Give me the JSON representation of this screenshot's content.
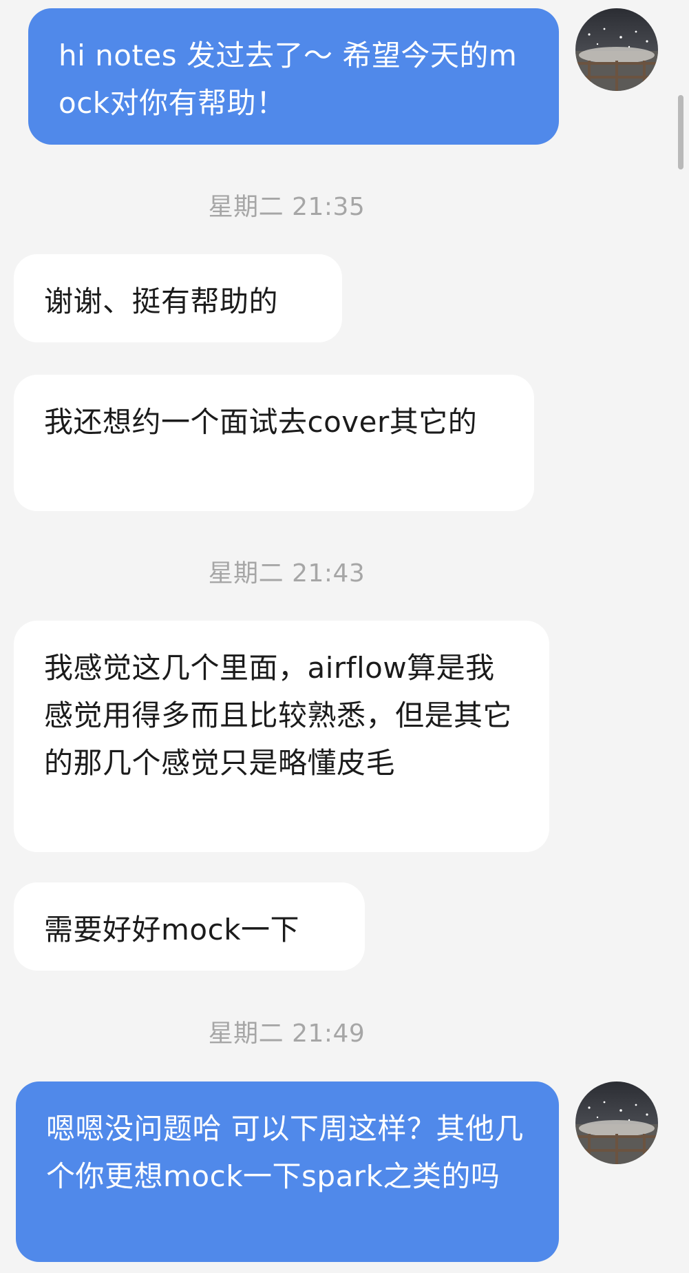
{
  "conversation": {
    "messages": [
      {
        "direction": "out",
        "text": "hi notes 发过去了～ 希望今天的mock对你有帮助！"
      },
      {
        "direction": "in",
        "text": "谢谢、挺有帮助的"
      },
      {
        "direction": "in",
        "text": "我还想约一个面试去cover其它的"
      },
      {
        "direction": "in",
        "text": "我感觉这几个里面，airflow算是我感觉用得多而且比较熟悉，但是其它的那几个感觉只是略懂皮毛"
      },
      {
        "direction": "in",
        "text": "需要好好mock一下"
      },
      {
        "direction": "out",
        "text": "嗯嗯没问题哈 可以下周这样？其他几个你更想mock一下spark之类的吗"
      }
    ],
    "timestamps": [
      "星期二 21:35",
      "星期二 21:43",
      "星期二 21:49"
    ]
  },
  "colors": {
    "background": "#f4f4f4",
    "outgoing_bubble": "#5089ea",
    "incoming_bubble": "#ffffff",
    "timestamp_text": "#a6a6a6"
  },
  "icons": {
    "avatar": "avatar-image"
  }
}
